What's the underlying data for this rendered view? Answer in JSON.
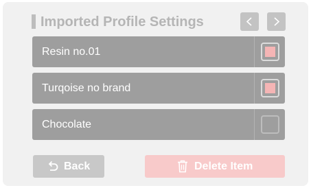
{
  "header": {
    "title": "Imported Profile Settings",
    "prev_icon": "chevron-left-icon",
    "next_icon": "chevron-right-icon"
  },
  "profiles": [
    {
      "label": "Resin no.01",
      "checked": true
    },
    {
      "label": "Turqoise no brand",
      "checked": true
    },
    {
      "label": "Chocolate",
      "checked": false
    }
  ],
  "footer": {
    "back_label": "Back",
    "back_icon": "undo-arrow-icon",
    "delete_label": "Delete Item",
    "delete_icon": "trash-icon"
  },
  "colors": {
    "item_background": "#9e9e9e",
    "checked_fill": "#f5b5b5",
    "delete_button": "#f8caca",
    "back_button": "#c8c8c8"
  }
}
